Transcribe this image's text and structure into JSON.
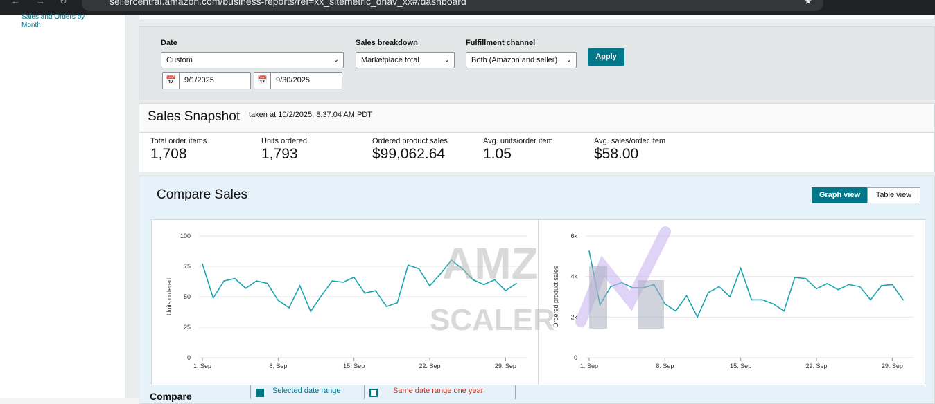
{
  "browser": {
    "url": "sellercentral.amazon.com/business-reports/ref=xx_sitemetric_dnav_xx#/dashboard"
  },
  "sidebar": {
    "link": "Sales and Orders by Month"
  },
  "filters": {
    "date_label": "Date",
    "date_value": "Custom",
    "start_date": "9/1/2025",
    "end_date": "9/30/2025",
    "breakdown_label": "Sales breakdown",
    "breakdown_value": "Marketplace total",
    "channel_label": "Fulfillment channel",
    "channel_value": "Both (Amazon and seller)",
    "apply_label": "Apply"
  },
  "snapshot": {
    "title": "Sales Snapshot",
    "taken": "taken at 10/2/2025, 8:37:04 AM PDT",
    "metrics": [
      {
        "label": "Total order items",
        "value": "1,708"
      },
      {
        "label": "Units ordered",
        "value": "1,793"
      },
      {
        "label": "Ordered product sales",
        "value": "$99,062.64"
      },
      {
        "label": "Avg. units/order item",
        "value": "1.05"
      },
      {
        "label": "Avg. sales/order item",
        "value": "$58.00"
      }
    ]
  },
  "compare": {
    "title": "Compare Sales",
    "graph_view_label": "Graph view",
    "table_view_label": "Table view",
    "legend_title": "Compare",
    "legend_selected": "Selected date range",
    "legend_last_year": "Same date range one year"
  },
  "watermark": {
    "line1": "AMZ",
    "line2": "SCALER"
  },
  "colors": {
    "line": "#1aa3b0",
    "button": "#00788a",
    "link": "#007185",
    "last_year": "#c0392b"
  },
  "chart_data": [
    {
      "type": "line",
      "ylabel": "Units ordered",
      "ylim": [
        0,
        100
      ],
      "yticks": [
        "0",
        "25",
        "50",
        "75",
        "100"
      ],
      "xticks": [
        "1. Sep",
        "8. Sep",
        "15. Sep",
        "22. Sep",
        "29. Sep"
      ],
      "x": [
        1,
        2,
        3,
        4,
        5,
        6,
        7,
        8,
        9,
        10,
        11,
        12,
        13,
        14,
        15,
        16,
        17,
        18,
        19,
        20,
        21,
        22,
        23,
        24,
        25,
        26,
        27,
        28,
        29,
        30
      ],
      "values": [
        77,
        49,
        63,
        65,
        57,
        63,
        61,
        47,
        41,
        59,
        38,
        51,
        63,
        62,
        66,
        53,
        55,
        42,
        45,
        76,
        73,
        59,
        69,
        80,
        73,
        64,
        60,
        64,
        55,
        61
      ]
    },
    {
      "type": "line",
      "ylabel": "Ordered product sales",
      "ylim": [
        0,
        6000
      ],
      "yticks": [
        "0",
        "2k",
        "4k",
        "6k"
      ],
      "xticks": [
        "1. Sep",
        "8. Sep",
        "15. Sep",
        "22. Sep",
        "29. Sep"
      ],
      "x": [
        1,
        2,
        3,
        4,
        5,
        6,
        7,
        8,
        9,
        10,
        11,
        12,
        13,
        14,
        15,
        16,
        17,
        18,
        19,
        20,
        21,
        22,
        23,
        24,
        25,
        26,
        27,
        28,
        29,
        30
      ],
      "values": [
        5250,
        2600,
        3500,
        3700,
        3450,
        3450,
        3600,
        2650,
        2300,
        3050,
        2000,
        3200,
        3500,
        3000,
        4400,
        2850,
        2850,
        2650,
        2300,
        3950,
        3900,
        3400,
        3650,
        3350,
        3600,
        3500,
        2850,
        3550,
        3600,
        2850
      ]
    }
  ]
}
